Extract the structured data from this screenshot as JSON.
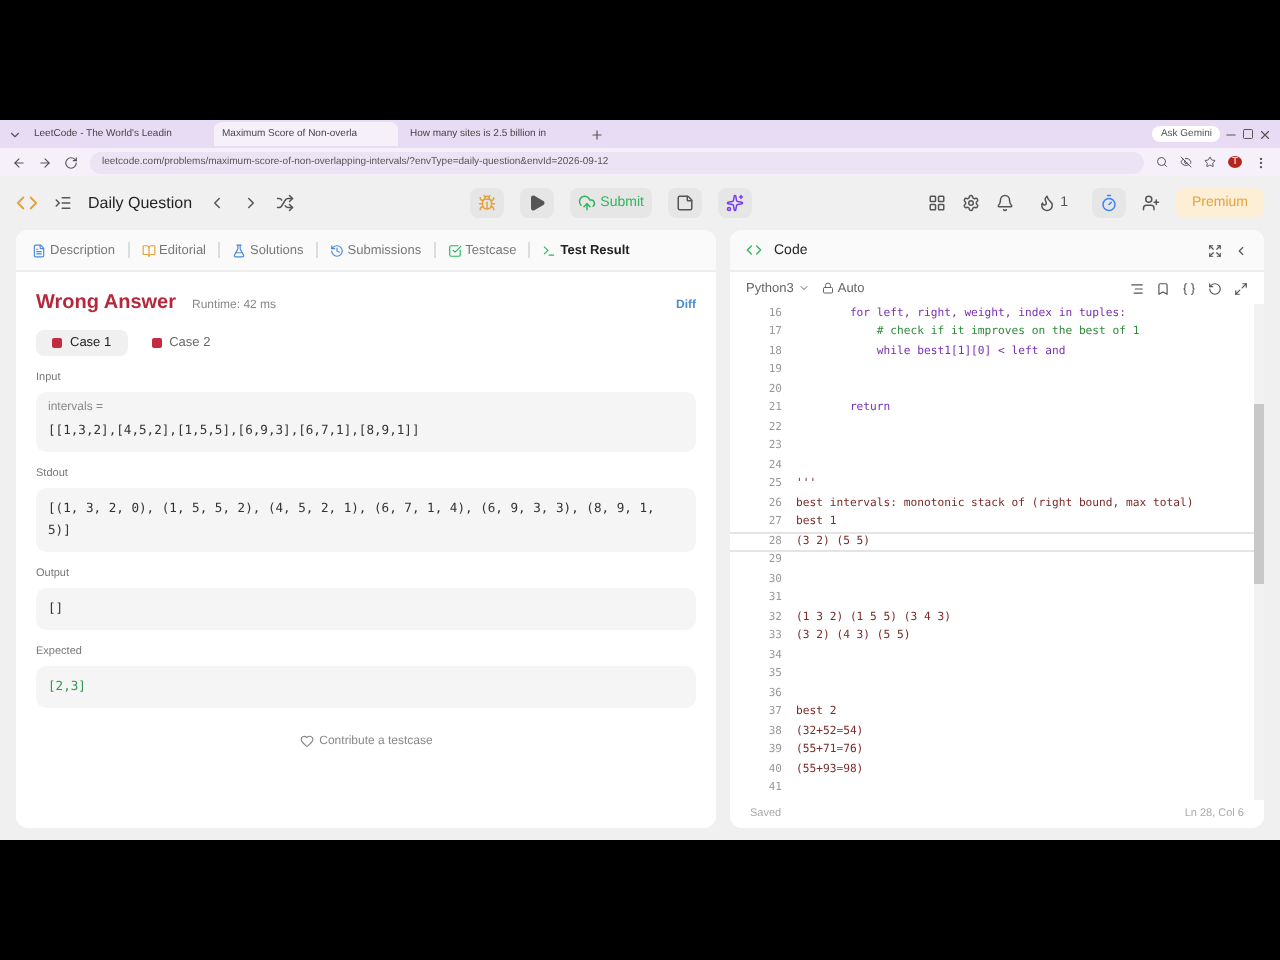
{
  "browser": {
    "tabs": [
      {
        "title": "LeetCode - The World's Leadin",
        "selected": false
      },
      {
        "title": "Maximum Score of Non-overla",
        "selected": true
      },
      {
        "title": "How many sites is 2.5 billion in",
        "selected": false
      }
    ],
    "ask_button": "Ask Gemini",
    "url": "leetcode.com/problems/maximum-score-of-non-overlapping-intervals/?envType=daily-question&envId=2026-09-12",
    "profile_initial": "T"
  },
  "nav": {
    "title": "Daily Question",
    "submit": "Submit",
    "streak": "1",
    "premium": "Premium"
  },
  "left_tabs": [
    {
      "label": "Description",
      "selected": false
    },
    {
      "label": "Editorial",
      "selected": false
    },
    {
      "label": "Solutions",
      "selected": false
    },
    {
      "label": "Submissions",
      "selected": false
    },
    {
      "label": "Testcase",
      "selected": false
    },
    {
      "label": "Test Result",
      "selected": true
    }
  ],
  "result": {
    "verdict": "Wrong Answer",
    "runtime": "Runtime: 42 ms",
    "diff": "Diff",
    "cases": [
      {
        "label": "Case 1",
        "selected": true
      },
      {
        "label": "Case 2",
        "selected": false
      }
    ],
    "sections": [
      {
        "label": "Input",
        "param": "intervals =",
        "value": "[[1,3,2],[4,5,2],[1,5,5],[6,9,3],[6,7,1],[8,9,1]]",
        "kind": "plain"
      },
      {
        "label": "Stdout",
        "value": "[(1, 3, 2, 0), (1, 5, 5, 2), (4, 5, 2, 1), (6, 7, 1, 4), (6, 9, 3, 3), (8, 9, 1, 5)]",
        "kind": "plain"
      },
      {
        "label": "Output",
        "value": "[]",
        "kind": "plain"
      },
      {
        "label": "Expected",
        "value": "[2,3]",
        "kind": "expected"
      }
    ],
    "contribute": "Contribute a testcase"
  },
  "editor": {
    "title": "Code",
    "language": "Python3",
    "mode": "Auto",
    "lines": [
      {
        "n": "16",
        "text": "        for left, right, weight, index in tuples:",
        "kind": "code",
        "current": false
      },
      {
        "n": "17",
        "text": "            # check if it improves on the best of 1",
        "kind": "comment",
        "current": false
      },
      {
        "n": "18",
        "text": "            while best1[1][0] < left and",
        "kind": "code",
        "current": false
      },
      {
        "n": "19",
        "current": false
      },
      {
        "n": "20",
        "current": false
      },
      {
        "n": "21",
        "text": "        return",
        "kind": "code",
        "current": false
      },
      {
        "n": "22",
        "current": false
      },
      {
        "n": "23",
        "current": false
      },
      {
        "n": "24",
        "current": false
      },
      {
        "n": "25",
        "text": "'''",
        "kind": "string",
        "current": false
      },
      {
        "n": "26",
        "text": "best intervals: monotonic stack of (right bound, max total)",
        "kind": "string",
        "current": false
      },
      {
        "n": "27",
        "text": "best 1",
        "kind": "string",
        "current": false
      },
      {
        "n": "28",
        "text": "(3 2) (5 5)",
        "kind": "string",
        "current": true
      },
      {
        "n": "29",
        "current": false
      },
      {
        "n": "30",
        "current": false
      },
      {
        "n": "31",
        "current": false
      },
      {
        "n": "32",
        "text": "(1 3 2) (1 5 5) (3 4 3)",
        "kind": "string",
        "current": false
      },
      {
        "n": "33",
        "text": "(3 2) (4 3) (5 5)",
        "kind": "string",
        "current": false
      },
      {
        "n": "34",
        "current": false
      },
      {
        "n": "35",
        "current": false
      },
      {
        "n": "36",
        "current": false
      },
      {
        "n": "37",
        "text": "best 2",
        "kind": "string",
        "current": false
      },
      {
        "n": "38",
        "text": "(32+52=54)",
        "kind": "string",
        "current": false
      },
      {
        "n": "39",
        "text": "(55+71=76)",
        "kind": "string",
        "current": false
      },
      {
        "n": "40",
        "text": "(55+93=98)",
        "kind": "string",
        "current": false
      },
      {
        "n": "41",
        "current": false
      }
    ],
    "status": "Saved",
    "position": "Ln 28, Col 6"
  }
}
